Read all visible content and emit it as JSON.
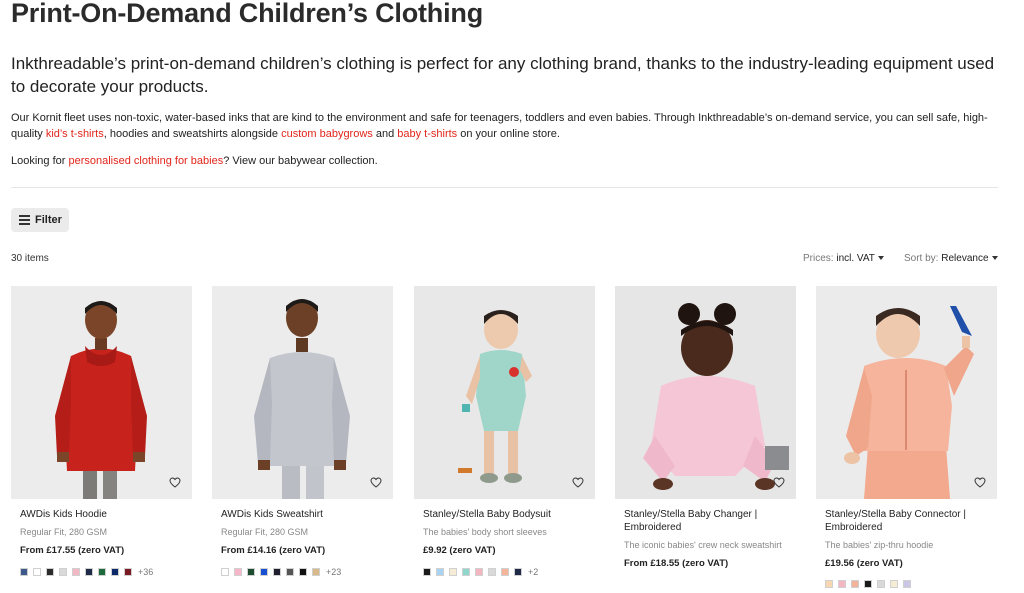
{
  "page": {
    "title": "Print-On-Demand Children’s Clothing",
    "lead": "Inkthreadable’s print-on-demand children’s clothing is perfect for any clothing brand, thanks to the industry-leading equipment used to decorate your products.",
    "body_1": "Our Kornit fleet uses non-toxic, water-based inks that are kind to the environment and safe for teenagers, toddlers and even babies. Through Inkthreadable’s on-demand service, you can sell safe, high-quality ",
    "link_kids_tshirts": "kid’s t-shirts",
    "body_2": ", hoodies and sweatshirts alongside ",
    "link_custom_babygrows": "custom babygrows",
    "body_3": " and ",
    "link_baby_tshirts": "baby t-shirts",
    "body_4": " on your online store.",
    "looking_1": "Looking for ",
    "link_personalised": "personalised clothing for babies",
    "looking_2": "? View our babywear collection."
  },
  "toolbar": {
    "filter_label": "Filter",
    "items_count": "30 items",
    "prices_label": "Prices:",
    "prices_value": "incl. VAT",
    "sort_label": "Sort by:",
    "sort_value": "Relevance"
  },
  "colors": {
    "link": "#e1251b",
    "heart_icon": "heart-outline-icon"
  },
  "products": [
    {
      "name": "AWDis Kids Hoodie",
      "subtitle": "Regular Fit, 280 GSM",
      "price": "From £17.55 (zero VAT)",
      "swatches": [
        "#3d5a8a",
        "#ffffff",
        "#2b2b2b",
        "#d9d9d9",
        "#f2b8c6",
        "#1f2a48",
        "#1d6b3c",
        "#0c2a6a",
        "#7a1a22"
      ],
      "more": "+36"
    },
    {
      "name": "AWDis Kids Sweatshirt",
      "subtitle": "Regular Fit, 280 GSM",
      "price": "From £14.16 (zero VAT)",
      "swatches": [
        "#ffffff",
        "#f4b6c8",
        "#1d4d2e",
        "#1a4fd1",
        "#1e1e2e",
        "#555555",
        "#111111",
        "#d8b98a"
      ],
      "more": "+23"
    },
    {
      "name": "Stanley/Stella Baby Bodysuit",
      "subtitle": "The babies' body short sleeves",
      "price": "£9.92 (zero VAT)",
      "swatches": [
        "#1a1a1a",
        "#a9d3f0",
        "#f6ecd6",
        "#8fd6cc",
        "#f3b6c1",
        "#d9d9d9",
        "#f5b59a",
        "#1f2a48"
      ],
      "more": "+2"
    },
    {
      "name": "Stanley/Stella Baby Changer | Embroidered",
      "subtitle": "The iconic babies' crew neck sweatshirt",
      "price": "From £18.55 (zero VAT)",
      "swatches": [],
      "more": ""
    },
    {
      "name": "Stanley/Stella Baby Connector | Embroidered",
      "subtitle": "The babies' zip-thru hoodie",
      "price": "£19.56 (zero VAT)",
      "swatches": [
        "#f6d7b0",
        "#f4b6c1",
        "#f2b39a",
        "#1a1a1a",
        "#d9d9d9",
        "#f6ecd6",
        "#c9c6e6"
      ],
      "more": ""
    }
  ]
}
